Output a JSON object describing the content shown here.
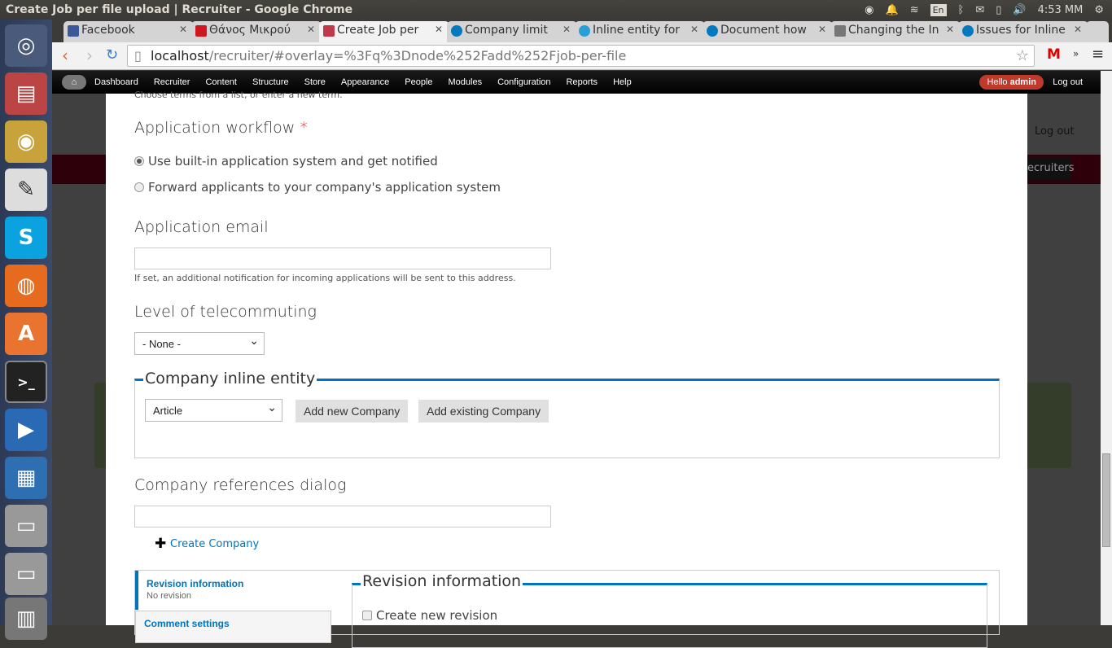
{
  "window": {
    "title": "Create Job per file upload | Recruiter - Google Chrome"
  },
  "tray": {
    "lang": "En",
    "time": "4:53 MM"
  },
  "tabs": [
    {
      "label": "Facebook",
      "color": "#3b5998"
    },
    {
      "label": "Θάνος Μικρού",
      "color": "#cc181e"
    },
    {
      "label": "Create Job per",
      "color": "#c0394b"
    },
    {
      "label": "Company limit",
      "color": "#0678be"
    },
    {
      "label": "Inline entity for",
      "color": "#2a9fd6"
    },
    {
      "label": "Document how",
      "color": "#0678be"
    },
    {
      "label": "Changing the In",
      "color": "#777777"
    },
    {
      "label": "Issues for Inline",
      "color": "#0678be"
    }
  ],
  "address": {
    "host": "localhost",
    "path": "/recruiter/#overlay=%3Fq%3Dnode%252Fadd%252Fjob-per-file"
  },
  "admin_menu": {
    "items": [
      "Dashboard",
      "Recruiter",
      "Content",
      "Structure",
      "Store",
      "Appearance",
      "People",
      "Modules",
      "Configuration",
      "Reports",
      "Help"
    ],
    "hello": "Hello ",
    "user": "admin",
    "logout": "Log out"
  },
  "background": {
    "logout": "Log out",
    "recruiters": "ecruiters"
  },
  "form": {
    "top_hint": "Choose terms from a list, or enter a new term.",
    "workflow": {
      "label": "Application workflow",
      "required": "*",
      "options": [
        {
          "label": "Use built-in application system and get notified",
          "checked": true
        },
        {
          "label": "Forward applicants to your company's application system",
          "checked": false
        }
      ]
    },
    "email": {
      "label": "Application email",
      "value": "",
      "description": "If set, an additional notification for incoming applications will be sent to this address."
    },
    "telecommuting": {
      "label": "Level of telecommuting",
      "selected": "- None -"
    },
    "company_inline": {
      "legend": "Company inline entity",
      "selected": "Article",
      "add_new": "Add new Company",
      "add_existing": "Add existing Company"
    },
    "company_refs": {
      "label": "Company references dialog",
      "value": "",
      "create_link": "Create Company"
    },
    "vertical_tabs": {
      "tabs": [
        {
          "title": "Revision information",
          "summary": "No revision"
        },
        {
          "title": "Comment settings"
        }
      ],
      "pane_legend": "Revision information",
      "create_revision": "Create new revision"
    }
  },
  "colors": {
    "accent": "#0074bd",
    "admin_badge": "#c0392b"
  }
}
